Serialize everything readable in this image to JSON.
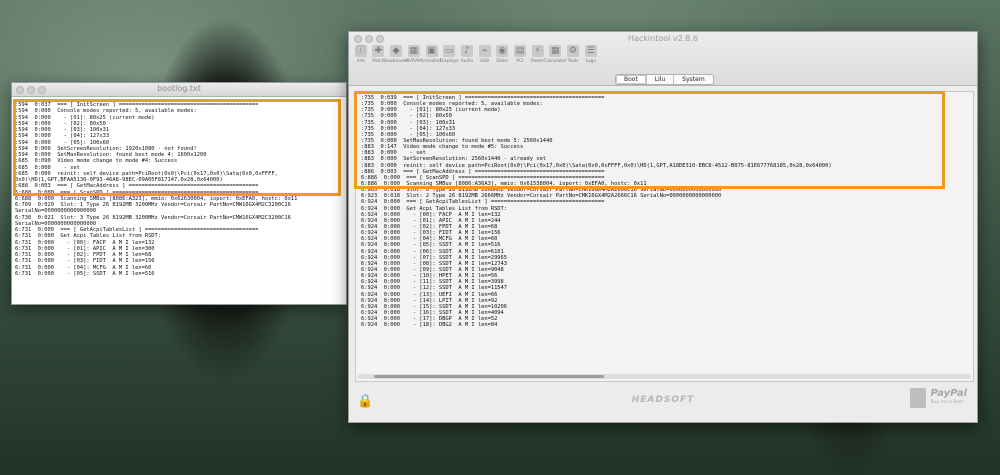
{
  "left_window": {
    "title": "bootlog.txt",
    "lines": [
      ":594  0:037  === [ InitScreen ] ===========================================",
      ":594  0:000  Console modes reported: 5, available modes:",
      ":594  0:000    - [01]: 80x25 (current mode)",
      ":594  0:000    - [02]: 80x50",
      ":594  0:000    - [03]: 100x31",
      ":594  0:000    - [04]: 127x33",
      ":594  0:000    - [05]: 100x60",
      ":594  0:000  SetScreenResolution: 1920x1080 - not found!",
      ":594  0:000  SetMaxResolution: found best mode 4: 1600x1200",
      ":685  0:090  Video mode change to mode #4: Success",
      ":685  0:000    - set",
      ":685  0:000  reinit: self device path=PciRoot(0x0)\\Pci(0x17,0x0)\\Sata(0x0,0xFFFF,",
      "0x0)\\HD(1,GPT,BFAA5130-0F93-46A8-98EC-09A05F817147,0x28,0x64000)",
      ":688  0:003  === [ GetMacAddress ] ========================================",
      "6:688  0:000  === [ ScanSPD ] =============================================",
      "6:688  0:000  Scanning SMBus [8086:A323], mmio: 0x62630004, ioport: 0xEFA0, hostc: 0x11",
      "6:709  0:020  Slot: 1 Type 26 8192MB 3200MHz Vendor=Corsair PartNo=CMW16GX4M2C3200C16",
      "SerialNo=0000000000000000",
      "6:730  0:021  Slot: 3 Type 26 8192MB 3200MHz Vendor=Corsair PartNo=CMW16GX4M2C3200C16",
      "SerialNo=0000000000000000",
      "6:731  0:000  === [ GetAcpiTablesList ] ===================================",
      "6:731  0:000  Get Acpi Tables List from RSDT:",
      "6:731  0:000    - [00]: FACP  A M I len=132",
      "6:731  0:000    - [01]: APIC  A M I len=300",
      "6:731  0:000    - [02]: FPDT  A M I len=68",
      "6:731  0:000    - [03]: FIDT  A M I len=156",
      "6:731  0:000    - [04]: MCFG  A M I len=60",
      "6:731  0:000    - [05]: SSDT  A M I len=516"
    ]
  },
  "right_window": {
    "title": "Hackintool v2.8.6",
    "toolbar": [
      "Info",
      "Patch",
      "Bootloader",
      "NVRAM",
      "Installed",
      "Displays",
      "Audio",
      "USB",
      "Disks",
      "PCI",
      "Power",
      "Calculator",
      "Tools",
      "Logs"
    ],
    "tabs": [
      "Boot",
      "Lilu",
      "System"
    ],
    "active_tab": "Boot",
    "lines": [
      ":735  0:039  === [ InitScreen ] ===========================================",
      ":735  0:000  Console modes reported: 5, available modes:",
      ":735  0:000    - [01]: 80x25 (current mode)",
      ":735  0:000    - [02]: 80x50",
      ":735  0:000    - [03]: 100x31",
      ":735  0:000    - [04]: 127x33",
      ":735  0:000    - [05]: 100x60",
      ":735  0:000  SetMaxResolution: found best mode 5: 2560x1440",
      ":883  0:147  Video mode change to mode #5: Success",
      ":883  0:000    - set",
      ":883  0:000  SetScreenResolution: 2560x1440 - already set",
      ":883  0:000  reinit: self device path=PciRoot(0x0)\\Pci(0x17,0x0)\\Sata(0x0,0xFFFF,0x0)\\HD(1,GPT,A18DE310-EBC8-4512-B075-81E677768185,0x28,0x64000)",
      ":886  0:003  === [ GetMacAddress ] ========================================",
      "6:886  0:000  === [ ScanSPD ] =============================================",
      "6:886  0:000  Scanning SMBus [8086:A36A3], mmio: 0x61538004, ioport: 0xEFA0, hostc: 0x11",
      "6:905  0:018  Slot: 0 Type 26 8192MB 2666MHz Vendor=Corsair PartNo=CMK16GX4M2A2666C16 SerialNo=0000000000000000",
      "6:923  0:018  Slot: 2 Type 26 8192MB 2666MHz Vendor=Corsair PartNo=CMK16GX4M2A2666C16 SerialNo=0000000000000000",
      "6:924  0:000  === [ GetAcpiTablesList ] ===================================",
      "6:924  0:000  Get Acpi Tables List from RSDT:",
      "6:924  0:000    - [00]: FACP  A M I len=132",
      "6:924  0:000    - [01]: APIC  A M I len=244",
      "6:924  0:000    - [02]: FPDT  A M I len=68",
      "6:924  0:000    - [03]: FIDT  A M I len=156",
      "6:924  0:000    - [04]: MCFG  A M I len=60",
      "6:924  0:000    - [05]: SSDT  A M I len=516",
      "6:924  0:000    - [06]: SSDT  A M I len=6101",
      "6:924  0:000    - [07]: SSDT  A M I len=29965",
      "6:924  0:000    - [08]: SSDT  A M I len=12743",
      "6:924  0:000    - [09]: SSDT  A M I len=9048",
      "6:924  0:000    - [10]: HPET  A M I len=56",
      "6:924  0:000    - [11]: SSDT  A M I len=3998",
      "6:924  0:000    - [12]: SSDT  A M I len=11547",
      "6:924  0:000    - [13]: UEFI  A M I len=66",
      "6:924  0:000    - [14]: LPIT  A M I len=92",
      "6:924  0:000    - [15]: SSDT  A M I len=10206",
      "6:924  0:000    - [16]: SSDT  A M I len=4094",
      "6:924  0:000    - [17]: DBGP  A M I len=52",
      "6:924  0:000    - [18]: DBG2  A M I len=84"
    ],
    "footer_brand": "HEADSOFT",
    "paypal": "PayPal",
    "paypal_sub": "Buy me a Beer"
  }
}
